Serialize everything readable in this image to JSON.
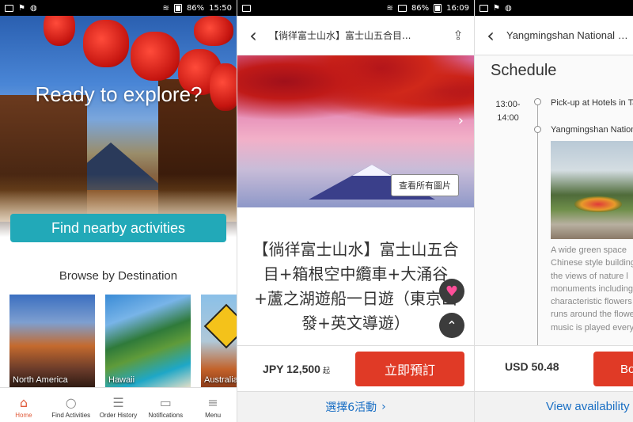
{
  "status_bars": [
    {
      "battery": "86%",
      "time": "15:50"
    },
    {
      "battery": "86%",
      "time": "16:09"
    },
    {
      "battery": "",
      "time": ""
    }
  ],
  "home": {
    "hero_title": "Ready to explore?",
    "find_button": "Find nearby activities",
    "browse_heading": "Browse by Destination",
    "destinations": [
      {
        "label": "North America"
      },
      {
        "label": "Hawaii"
      },
      {
        "label": "Australia"
      }
    ],
    "tabs": [
      {
        "label": "Home",
        "icon": "home-icon",
        "glyph": "⌂"
      },
      {
        "label": "Find Activities",
        "icon": "search-icon",
        "glyph": "○"
      },
      {
        "label": "Order History",
        "icon": "receipt-icon",
        "glyph": "☰"
      },
      {
        "label": "Notifications",
        "icon": "chat-icon",
        "glyph": "▭"
      },
      {
        "label": "Menu",
        "icon": "menu-icon",
        "glyph": "≡"
      }
    ]
  },
  "product": {
    "nav_title": "【徜徉富士山水】富士山五合目...",
    "view_all_photos": "查看所有圖片",
    "title": "【徜徉富士山水】富士山五合目+箱根空中纜車+大涌谷+蘆之湖遊船一日遊（東京出發+英文導遊）",
    "price": "JPY 12,500",
    "price_suffix": "起",
    "book_button": "立即預訂",
    "select_activities": "選擇6活動",
    "chevron": "›"
  },
  "tour": {
    "nav_title": "Yangmingshan National Park",
    "schedule_heading": "Schedule",
    "time_start": "13:00-",
    "time_end": "14:00",
    "event1": "Pick-up at Hotels in Taipei",
    "event2": "Yangmingshan National Park",
    "description_lines": [
      "A wide green space",
      "Chinese style buildings",
      "the views of nature l",
      "monuments including",
      "characteristic flowers",
      "runs around the flower",
      "music is played every"
    ],
    "price": "USD 50.48",
    "book_button": "Book",
    "view_availability": "View availability"
  },
  "colors": {
    "accent_teal": "#22a9b8",
    "book_red": "#e03a26",
    "link_blue": "#1a6fc4"
  }
}
